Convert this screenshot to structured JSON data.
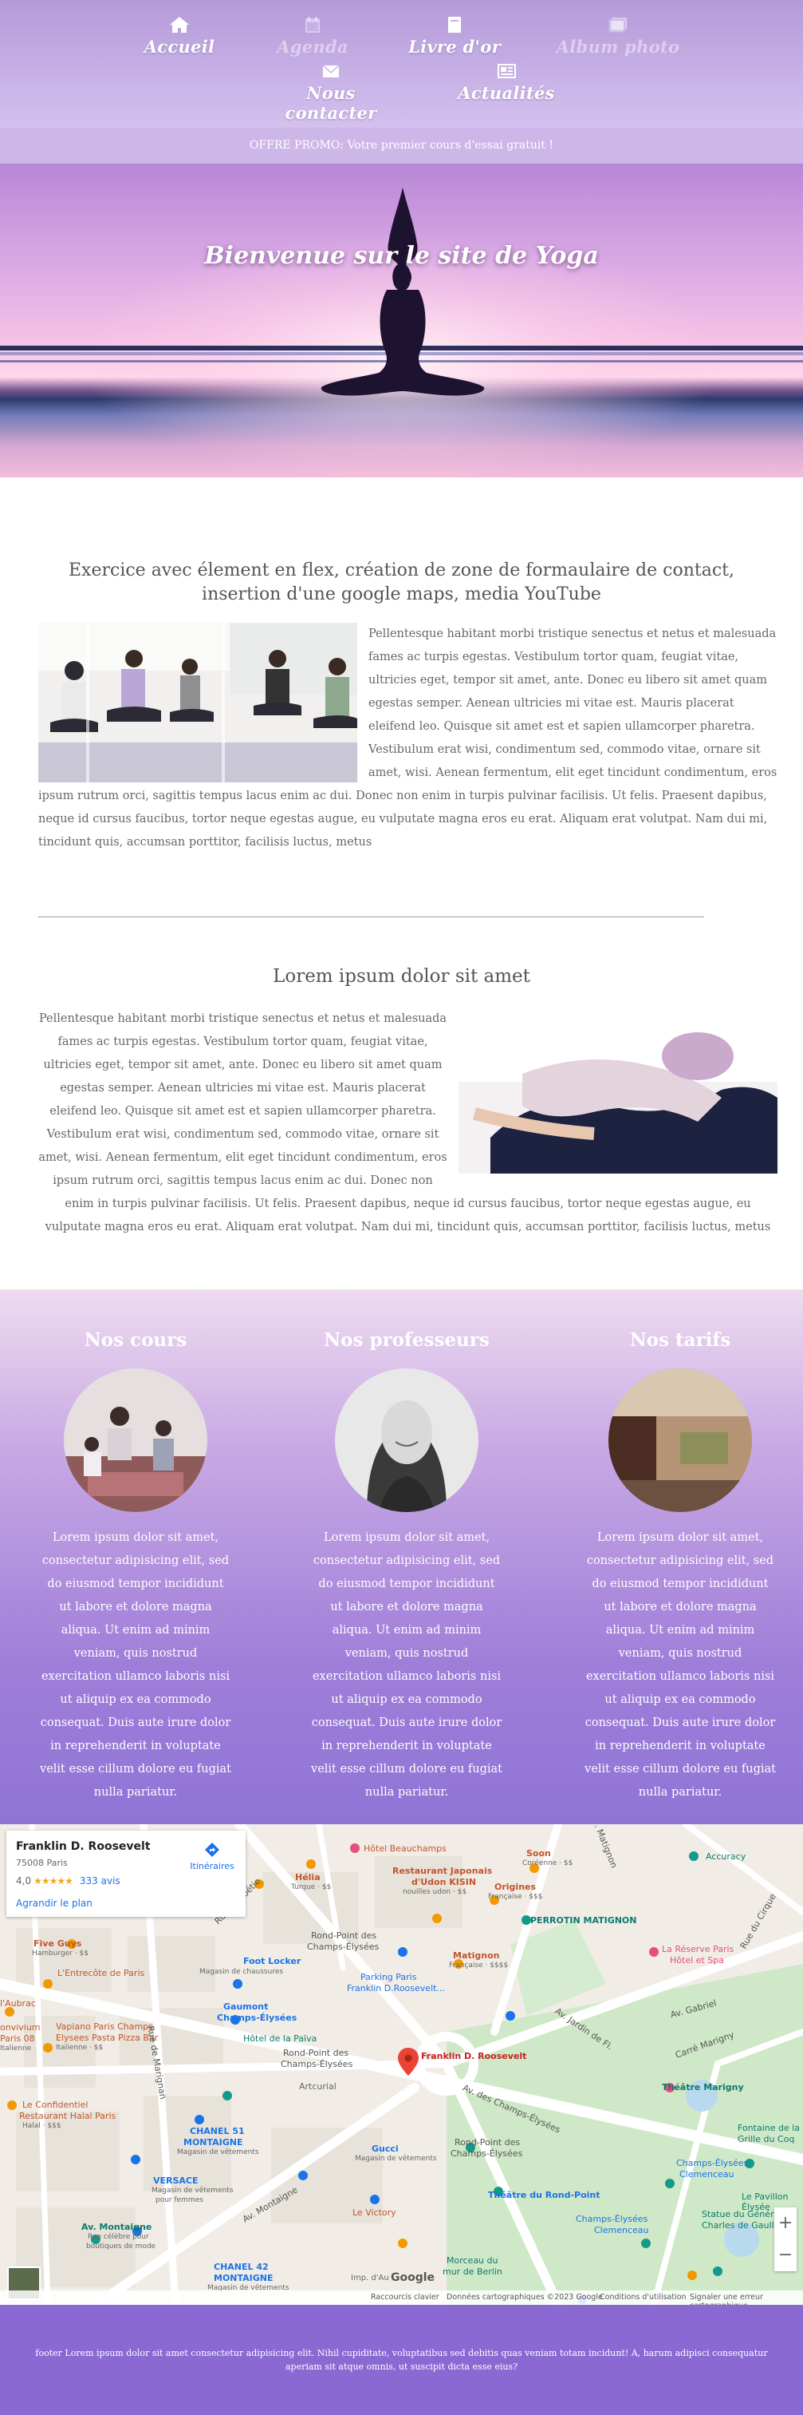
{
  "nav": {
    "items": [
      {
        "label": "Accueil",
        "icon": "home-icon"
      },
      {
        "label": "Agenda",
        "icon": "calendar-icon"
      },
      {
        "label": "Livre d'or",
        "icon": "book-icon"
      },
      {
        "label": "Album photo",
        "icon": "images-icon"
      },
      {
        "label": "Nous contacter",
        "icon": "envelope-icon"
      },
      {
        "label": "Actualités",
        "icon": "newspaper-icon"
      }
    ]
  },
  "promo": {
    "text": "OFFRE PROMO: Votre premier cours d'essai gratuit !"
  },
  "hero": {
    "title": "Bienvenue sur le site de Yoga"
  },
  "section1": {
    "title": "Exercice avec élement en flex, création de zone de formaulaire de contact, insertion d'une google maps, media YouTube",
    "text": "Pellentesque habitant morbi tristique senectus et netus et malesuada fames ac turpis egestas. Vestibulum tortor quam, feugiat vitae, ultricies eget, tempor sit amet, ante. Donec eu libero sit amet quam egestas semper. Aenean ultricies mi vitae est. Mauris placerat eleifend leo. Quisque sit amet est et sapien ullamcorper pharetra. Vestibulum erat wisi, condimentum sed, commodo vitae, ornare sit amet, wisi. Aenean fermentum, elit eget tincidunt condimentum, eros ipsum rutrum orci, sagittis tempus lacus enim ac dui. Donec non enim in turpis pulvinar facilisis. Ut felis. Praesent dapibus, neque id cursus faucibus, tortor neque egestas augue, eu vulputate magna eros eu erat. Aliquam erat volutpat. Nam dui mi, tincidunt quis, accumsan porttitor, facilisis luctus, metus"
  },
  "section2": {
    "title": "Lorem ipsum dolor sit amet",
    "text": "Pellentesque habitant morbi tristique senectus et netus et malesuada fames ac turpis egestas. Vestibulum tortor quam, feugiat vitae, ultricies eget, tempor sit amet, ante. Donec eu libero sit amet quam egestas semper. Aenean ultricies mi vitae est. Mauris placerat eleifend leo. Quisque sit amet est et sapien ullamcorper pharetra. Vestibulum erat wisi, condimentum sed, commodo vitae, ornare sit amet, wisi. Aenean fermentum, elit eget tincidunt condimentum, eros ipsum rutrum orci, sagittis tempus lacus enim ac dui. Donec non enim in turpis pulvinar facilisis. Ut felis. Praesent dapibus, neque id cursus faucibus, tortor neque egestas augue, eu vulputate magna eros eu erat. Aliquam erat volutpat. Nam dui mi, tincidunt quis, accumsan porttitor, facilisis luctus, metus"
  },
  "cards": [
    {
      "title": "Nos cours",
      "text": "Lorem ipsum dolor sit amet, consectetur adipisicing elit, sed do eiusmod tempor incididunt ut labore et dolore magna aliqua. Ut enim ad minim veniam, quis nostrud exercitation ullamco laboris nisi ut aliquip ex ea commodo consequat. Duis aute irure dolor in reprehenderit in voluptate velit esse cillum dolore eu fugiat nulla pariatur."
    },
    {
      "title": "Nos professeurs",
      "text": "Lorem ipsum dolor sit amet, consectetur adipisicing elit, sed do eiusmod tempor incididunt ut labore et dolore magna aliqua. Ut enim ad minim veniam, quis nostrud exercitation ullamco laboris nisi ut aliquip ex ea commodo consequat. Duis aute irure dolor in reprehenderit in voluptate velit esse cillum dolore eu fugiat nulla pariatur."
    },
    {
      "title": "Nos tarifs",
      "text": "Lorem ipsum dolor sit amet, consectetur adipisicing elit, sed do eiusmod tempor incididunt ut labore et dolore magna aliqua. Ut enim ad minim veniam, quis nostrud exercitation ullamco laboris nisi ut aliquip ex ea commodo consequat. Duis aute irure dolor in reprehenderit in voluptate velit esse cillum dolore eu fugiat nulla pariatur."
    }
  ],
  "map": {
    "place_name": "Franklin D. Roosevelt",
    "address": "75008 Paris",
    "rating": "4,0",
    "stars": "★★★★★",
    "reviews": "333 avis",
    "enlarge": "Agrandir le plan",
    "directions": "Itinéraires",
    "pin_label": "Franklin D. Roosevelt",
    "labels": {
      "hotel_beauchamps": "Hôtel Beauchamps",
      "helia": "Hélia",
      "helia_sub": "Turque · $$",
      "restaurant_japonais": "Restaurant Japonais",
      "restaurant_japonais2": "d'Udon KISIN",
      "restaurant_japonais_sub": "nouilles udon · $$",
      "soon": "Soon",
      "soon_sub": "Coréenne · $$",
      "origines": "Origines",
      "origines_sub": "Française · $$$",
      "accuracy": "Accuracy",
      "perrotin": "PERROTIN MATIGNON",
      "five_guys": "Five Guys",
      "five_guys_sub": "Hamburger · $$",
      "lentrecote": "L'Entrecôte de Paris",
      "foot_locker": "Foot Locker",
      "foot_locker_sub": "Magasin de chaussures",
      "rond_point": "Rond-Point des",
      "rond_point2": "Champs-Élysées",
      "matignon": "Matignon",
      "matignon_sub": "Française · $$$$",
      "parking": "Parking Paris",
      "parking2": "Franklin D.Roosevelt...",
      "reserve": "La Réserve Paris",
      "reserve2": "Hôtel et Spa",
      "laubrac": "l'Aubrac",
      "convivium": "onvivium",
      "paris08": "Paris 08",
      "paris08_sub": "Italienne",
      "vapiano": "Vapiano Paris Champs",
      "vapiano2": "Elysees Pasta Pizza Bar",
      "vapiano_sub": "Italienne · $$",
      "gaumont": "Gaumont",
      "gaumont2": "Champs-Élysées",
      "hotel_paiva": "Hôtel de la Païva",
      "rond_point_b": "Rond-Point des",
      "rond_point_b2": "Champs-Élysées",
      "artcurial": "Artcurial",
      "theatre_marigny": "Théâtre Marigny",
      "confidentiel": "Le Confidentiel",
      "confidentiel2": "Restaurant Halal Paris",
      "confidentiel_sub": "Halal · $$$",
      "chanel51": "CHANEL 51",
      "chanel51b": "MONTAIGNE",
      "chanel51_sub": "Magasin de vêtements",
      "gucci": "Gucci",
      "gucci_sub": "Magasin de vêtements",
      "rond_point_c": "Rond-Point des",
      "rond_point_c2": "Champs-Élysées",
      "pavillon": "Fontaine de la",
      "pavillon2": "Grille du Coq",
      "pavillon3": "Le Pavillon Élysée",
      "versace": "VERSACE",
      "versace_sub": "Magasin de vêtements",
      "versace_sub2": "pour femmes",
      "theatre_rond": "Théâtre du Rond-Point",
      "champs_clemenceau": "Champs-Élysées",
      "champs_clemenceau2": "Clemenceau",
      "champs_gen": "Champs-Élysées",
      "champs_gen2": "Clemenceau",
      "statue": "Statue du Général",
      "statue2": "Charles de Gaulle",
      "av_montaigne": "Av. Montaigne",
      "av_montaigne_sub": "Rue célèbre pour",
      "av_montaigne_sub2": "boutiques de mode",
      "le_victory": "Le Victory",
      "chanel42": "CHANEL 42",
      "chanel42b": "MONTAIGNE",
      "chanel42_sub": "Magasin de vêtements",
      "morceau": "Morceau du",
      "morceau2": "mur de Berlin",
      "reserve_sub": "",
      "av_champs": "Av. des Champs-Élysées",
      "av_gabriel": "Av. Gabriel",
      "av_matignon": "Av. Matignon",
      "rue_marignan": "Rue de Marignan",
      "av_montaigne_st": "Av. Montaigne",
      "rue_cirque": "Rue du Cirque",
      "carre_marigny": "Carré Marigny",
      "jardins": "Av. Jardin de Fl.",
      "rue_boetie": "Rue La Boétie"
    },
    "footer": {
      "shortcuts": "Raccourcis clavier",
      "data": "Données cartographiques ©2023 Google",
      "terms": "Conditions d'utilisation",
      "report": "Signaler une erreur cartographique",
      "imp": "Imp. d'Au"
    },
    "google": "Google",
    "zoom_in": "+",
    "zoom_out": "−"
  },
  "footer": {
    "text": "footer Lorem ipsum dolor sit amet consectetur adipisicing elit. Nihil cupiditate, voluptatibus sed debitis quas veniam totam incidunt! A, harum adipisci consequatur aperiam sit atque omnis, ut suscipit dicta esse eius?"
  },
  "colors": {
    "header": "#c7b1e6",
    "footer": "#8a6ad2",
    "cards_bottom": "#8f74d6"
  }
}
